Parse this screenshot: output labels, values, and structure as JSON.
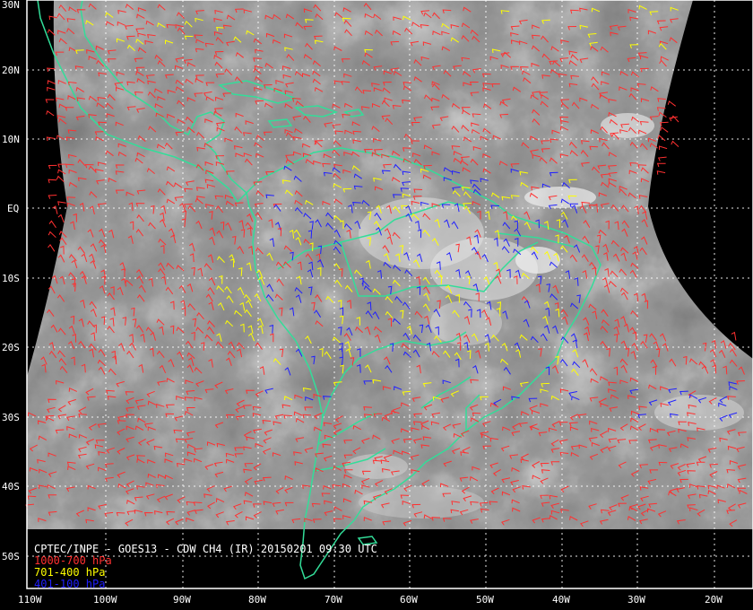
{
  "map": {
    "caption": "CPTEC/INPE - GOES13 - CDW CH4 (IR) 20150201 09:30 UTC",
    "legend": [
      {
        "label": "1000-700 hPa",
        "color": "#ff3030"
      },
      {
        "label": "701-400 hPa",
        "color": "#ffff00"
      },
      {
        "label": "401-100 hPa",
        "color": "#2020ff"
      }
    ],
    "lat_labels": [
      "30N",
      "20N",
      "10N",
      "EQ",
      "10S",
      "20S",
      "30S",
      "40S",
      "50S"
    ],
    "lon_labels": [
      "110W",
      "100W",
      "90W",
      "80W",
      "70W",
      "60W",
      "50W",
      "40W",
      "30W",
      "20W"
    ],
    "colors": {
      "coastline": "#33dd99",
      "grid": "#ffffff",
      "frame": "#ffffff",
      "background": "#000000"
    }
  }
}
